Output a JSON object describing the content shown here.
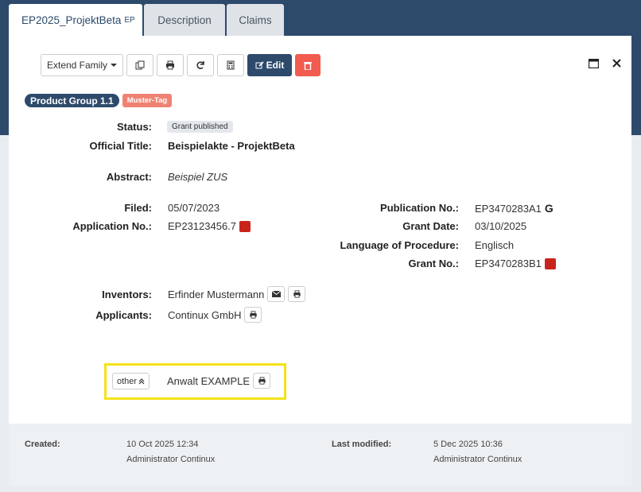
{
  "tabs": [
    {
      "label": "EP2025_ProjektBeta",
      "sub": "EP"
    },
    {
      "label": "Description"
    },
    {
      "label": "Claims"
    }
  ],
  "toolbar": {
    "extend_family": "Extend Family",
    "edit": "Edit"
  },
  "badges": {
    "product_group": "Product Group 1.1",
    "tag": "Muster-Tag"
  },
  "fields": {
    "status": {
      "label": "Status:",
      "value": "Grant published"
    },
    "official_title": {
      "label": "Official Title:",
      "value": "Beispielakte - ProjektBeta"
    },
    "abstract": {
      "label": "Abstract:",
      "value": "Beispiel ZUS"
    },
    "filed": {
      "label": "Filed:",
      "value": "05/07/2023"
    },
    "application_no": {
      "label": "Application No.:",
      "value": "EP23123456.7"
    },
    "publication_no": {
      "label": "Publication No.:",
      "value": "EP3470283A1",
      "suffix": "G"
    },
    "grant_date": {
      "label": "Grant Date:",
      "value": "03/10/2025"
    },
    "language": {
      "label": "Language of Procedure:",
      "value": "Englisch"
    },
    "grant_no": {
      "label": "Grant No.:",
      "value": "EP3470283B1"
    },
    "inventors": {
      "label": "Inventors:",
      "value": "Erfinder Mustermann"
    },
    "applicants": {
      "label": "Applicants:",
      "value": "Continux GmbH"
    }
  },
  "other": {
    "button": "other",
    "value": "Anwalt EXAMPLE"
  },
  "footer": {
    "created_label": "Created:",
    "created_date": "10 Oct 2025 12:34",
    "created_by": "Administrator Continux",
    "modified_label": "Last modified:",
    "modified_date": "5 Dec 2025 10:36",
    "modified_by": "Administrator Continux"
  }
}
